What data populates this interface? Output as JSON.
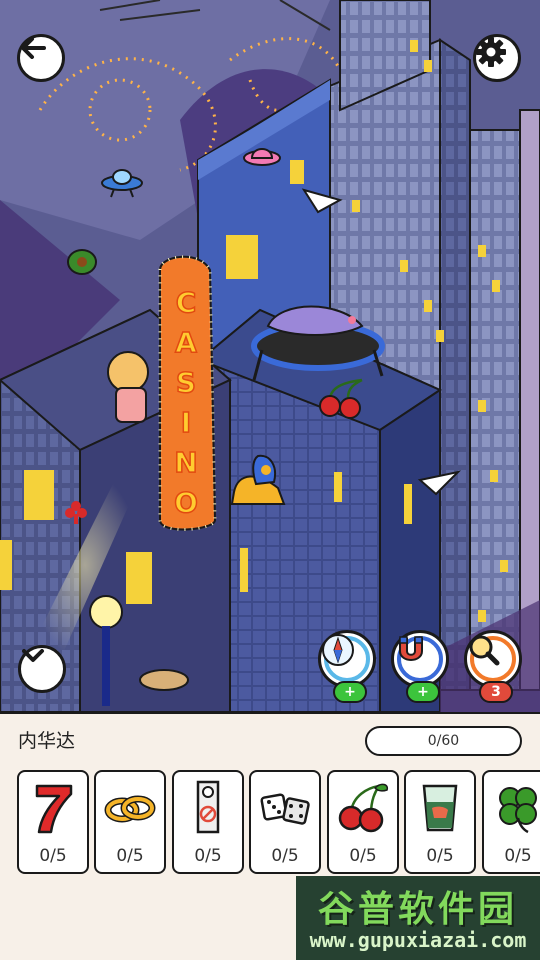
{
  "level": {
    "location_name": "内华达",
    "progress_text": "0/60"
  },
  "scene": {
    "casino_sign_text": "CASINO"
  },
  "tools": [
    {
      "name": "compass",
      "icon": "compass-icon",
      "badge": "+",
      "badge_color": "#3cc43c"
    },
    {
      "name": "magnet",
      "icon": "magnet-icon",
      "badge": "+",
      "badge_color": "#3cc43c"
    },
    {
      "name": "magnifier",
      "icon": "magnifier-icon",
      "badge": "3",
      "badge_color": "#e14a3b"
    }
  ],
  "items": [
    {
      "name": "lucky-seven",
      "icon": "seven-icon",
      "count": "0/5"
    },
    {
      "name": "wedding-rings",
      "icon": "rings-icon",
      "count": "0/5"
    },
    {
      "name": "door-hanger",
      "icon": "door-hanger-icon",
      "count": "0/5"
    },
    {
      "name": "dice",
      "icon": "dice-icon",
      "count": "0/5"
    },
    {
      "name": "cherries",
      "icon": "cherries-icon",
      "count": "0/5"
    },
    {
      "name": "drink-glass",
      "icon": "glass-icon",
      "count": "0/5"
    },
    {
      "name": "clover",
      "icon": "clover-icon",
      "count": "0/5"
    }
  ],
  "watermark": {
    "title": "谷普软件园",
    "url": "www.gupuxiazai.com"
  },
  "colors": {
    "panel_bg": "#f7f0e8",
    "sky": "#5a5a8e",
    "sign_orange": "#f27a2a",
    "window_yellow": "#f5d23a",
    "badge_green": "#3cc43c",
    "badge_red": "#e14a3b"
  }
}
